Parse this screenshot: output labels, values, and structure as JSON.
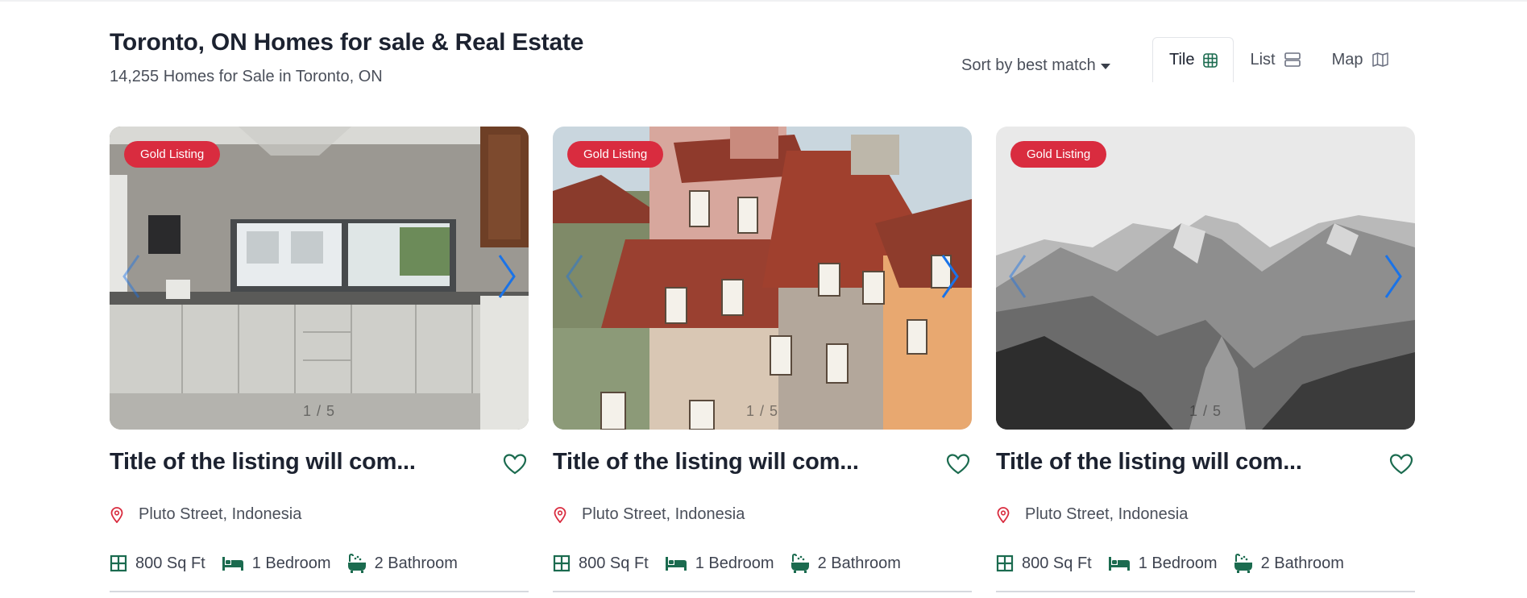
{
  "header": {
    "title": "Toronto, ON Homes for sale & Real Estate",
    "subtitle": "14,255 Homes for Sale in Toronto, ON"
  },
  "sort": {
    "label": "Sort by best match"
  },
  "views": [
    {
      "label": "Tile",
      "icon": "grid-icon",
      "active": true
    },
    {
      "label": "List",
      "icon": "list-icon",
      "active": false
    },
    {
      "label": "Map",
      "icon": "map-icon",
      "active": false
    }
  ],
  "colors": {
    "badge": "#d92c3f",
    "accent_green": "#1b6b4f",
    "arrow_blue": "#1a73e8",
    "pin_red": "#d92c3f"
  },
  "listings": [
    {
      "badge": "Gold Listing",
      "photo": "kitchen-photo",
      "counter": "1 / 5",
      "title": "Title of the listing will com...",
      "address": "Pluto Street, Indonesia",
      "area": "800 Sq Ft",
      "bedrooms": "1 Bedroom",
      "bathrooms": "2 Bathroom"
    },
    {
      "badge": "Gold Listing",
      "photo": "townhouses-photo",
      "counter": "1 / 5",
      "title": "Title of the listing will com...",
      "address": "Pluto Street, Indonesia",
      "area": "800 Sq Ft",
      "bedrooms": "1 Bedroom",
      "bathrooms": "2 Bathroom"
    },
    {
      "badge": "Gold Listing",
      "photo": "mountains-photo",
      "counter": "1 / 5",
      "title": "Title of the listing will com...",
      "address": "Pluto Street, Indonesia",
      "area": "800 Sq Ft",
      "bedrooms": "1 Bedroom",
      "bathrooms": "2 Bathroom"
    }
  ]
}
